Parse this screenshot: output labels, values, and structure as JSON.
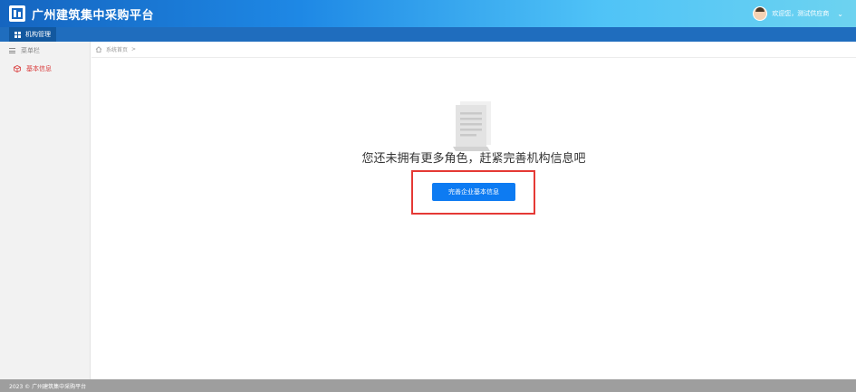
{
  "header": {
    "title": "广州建筑集中采购平台",
    "welcome": "欢迎您，测试供应商",
    "logo_icon": "building-logo-icon",
    "dropdown_icon": "chevron-down-icon"
  },
  "nav": {
    "items": [
      {
        "label": "机构管理",
        "icon": "grid-icon"
      }
    ]
  },
  "sidebar": {
    "header_label": "菜单栏",
    "items": [
      {
        "label": "基本信息",
        "icon": "cube-icon",
        "active": true
      }
    ]
  },
  "breadcrumb": {
    "home_label": "系统首页",
    "separator": ">"
  },
  "main": {
    "empty_message": "您还未拥有更多角色，赶紧完善机构信息吧",
    "button_label": "完善企业基本信息"
  },
  "footer": {
    "text": "2023 © 广州建筑集中采购平台"
  },
  "colors": {
    "header_start": "#1565c0",
    "header_end": "#6dd3f0",
    "nav_bg": "#1f6dbe",
    "active_text": "#d93a3a",
    "button_bg": "#0d7bf2",
    "highlight": "#e53935",
    "footer_bg": "#9e9e9e"
  }
}
